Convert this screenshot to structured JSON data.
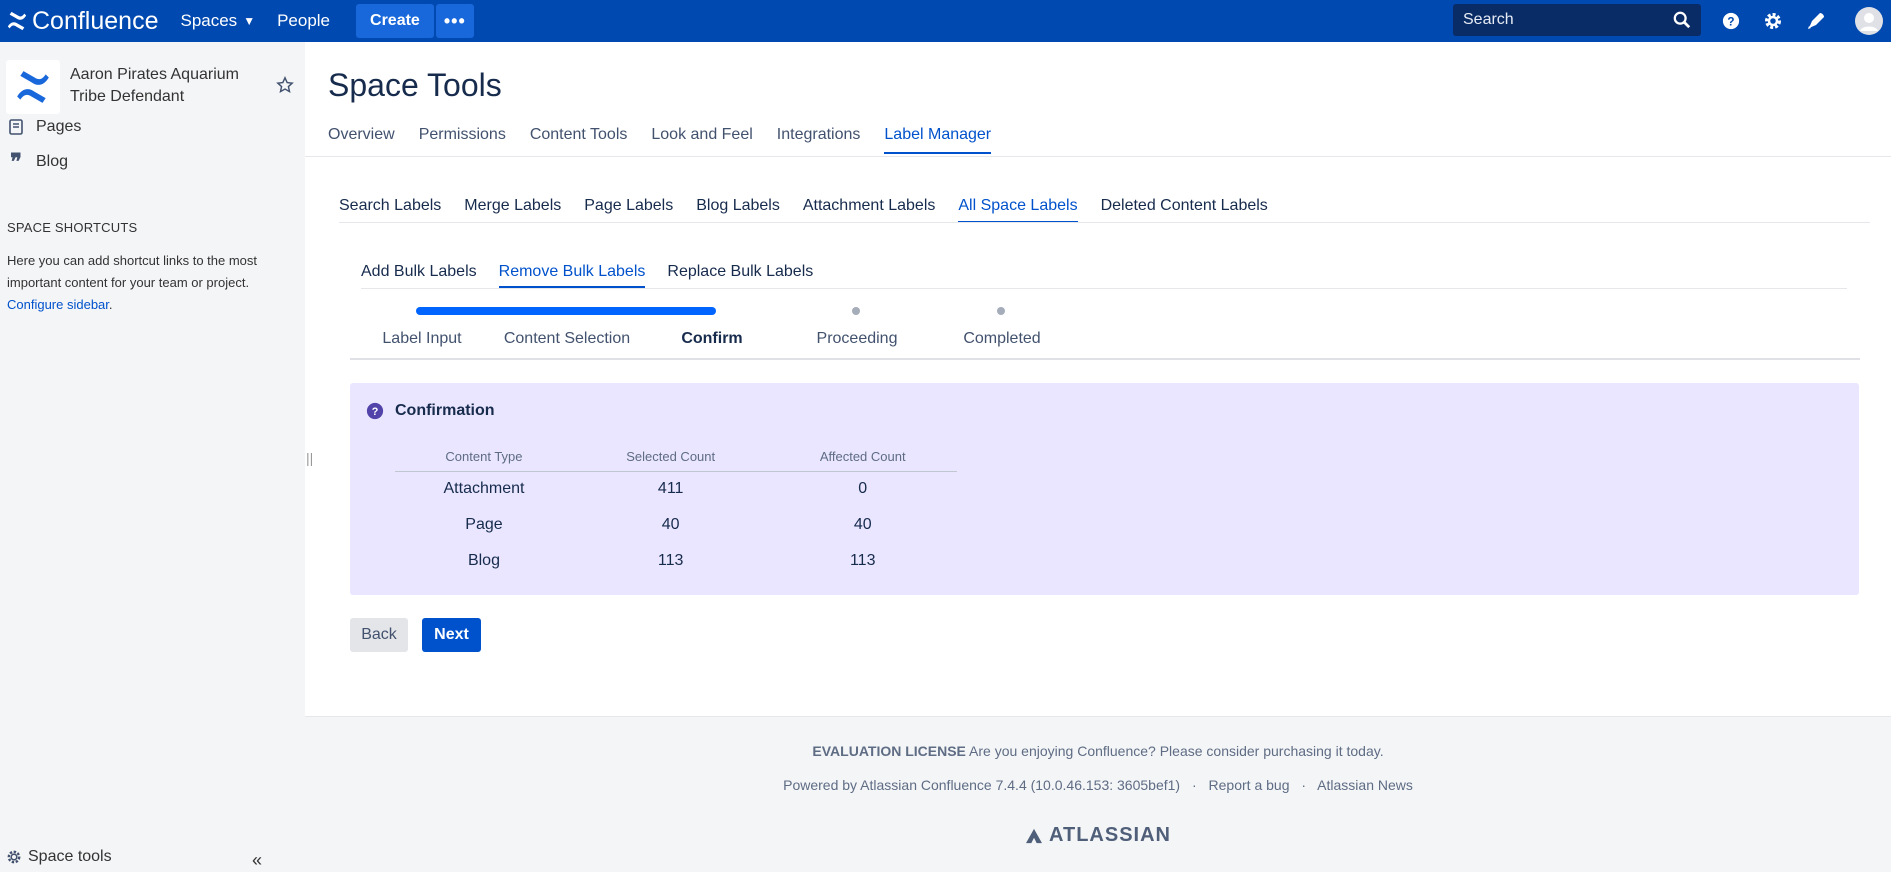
{
  "topbar": {
    "logo_text": "Confluence",
    "nav": {
      "spaces": "Spaces",
      "people": "People"
    },
    "create_label": "Create",
    "more_label": "•••",
    "search_placeholder": "Search",
    "icons": [
      "help-icon",
      "settings-icon",
      "notifications-icon",
      "avatar"
    ]
  },
  "sidebar": {
    "space_name": "Aaron Pirates Aquarium Tribe Defendant",
    "items": [
      {
        "label": "Pages",
        "icon": "pages-icon"
      },
      {
        "label": "Blog",
        "icon": "blog-icon"
      }
    ],
    "shortcuts_title": "SPACE SHORTCUTS",
    "shortcuts_text": "Here you can add shortcut links to the most important content for your team or project.",
    "configure_link": "Configure sidebar",
    "space_tools": "Space tools",
    "collapse": "«"
  },
  "main": {
    "title": "Space Tools",
    "tabs": [
      "Overview",
      "Permissions",
      "Content Tools",
      "Look and Feel",
      "Integrations",
      "Label Manager"
    ],
    "active_tab": "Label Manager",
    "sub_tabs": [
      "Search Labels",
      "Merge Labels",
      "Page Labels",
      "Blog Labels",
      "Attachment Labels",
      "All Space Labels",
      "Deleted Content Labels"
    ],
    "active_sub_tab": "All Space Labels",
    "bulk_tabs": [
      "Add Bulk Labels",
      "Remove Bulk Labels",
      "Replace Bulk Labels"
    ],
    "active_bulk_tab": "Remove Bulk Labels",
    "steps": [
      "Label Input",
      "Content Selection",
      "Confirm",
      "Proceeding",
      "Completed"
    ],
    "current_step": "Confirm",
    "confirmation": {
      "title": "Confirmation",
      "headers": [
        "Content Type",
        "Selected Count",
        "Affected Count"
      ],
      "rows": [
        [
          "Attachment",
          "411",
          "0"
        ],
        [
          "Page",
          "40",
          "40"
        ],
        [
          "Blog",
          "113",
          "113"
        ]
      ]
    },
    "back_label": "Back",
    "next_label": "Next"
  },
  "footer": {
    "license_bold": "EVALUATION LICENSE",
    "license_text": "Are you enjoying Confluence? Please consider purchasing it today.",
    "powered": "Powered by Atlassian Confluence 7.4.4 (10.0.46.153: 3605bef1)",
    "report_bug": "Report a bug",
    "news": "Atlassian News",
    "brand": "ATLASSIAN"
  },
  "colors": {
    "topbar": "#0049b0",
    "accent": "#0052cc",
    "panel": "#eae6ff",
    "sidebar": "#f4f5f7"
  }
}
